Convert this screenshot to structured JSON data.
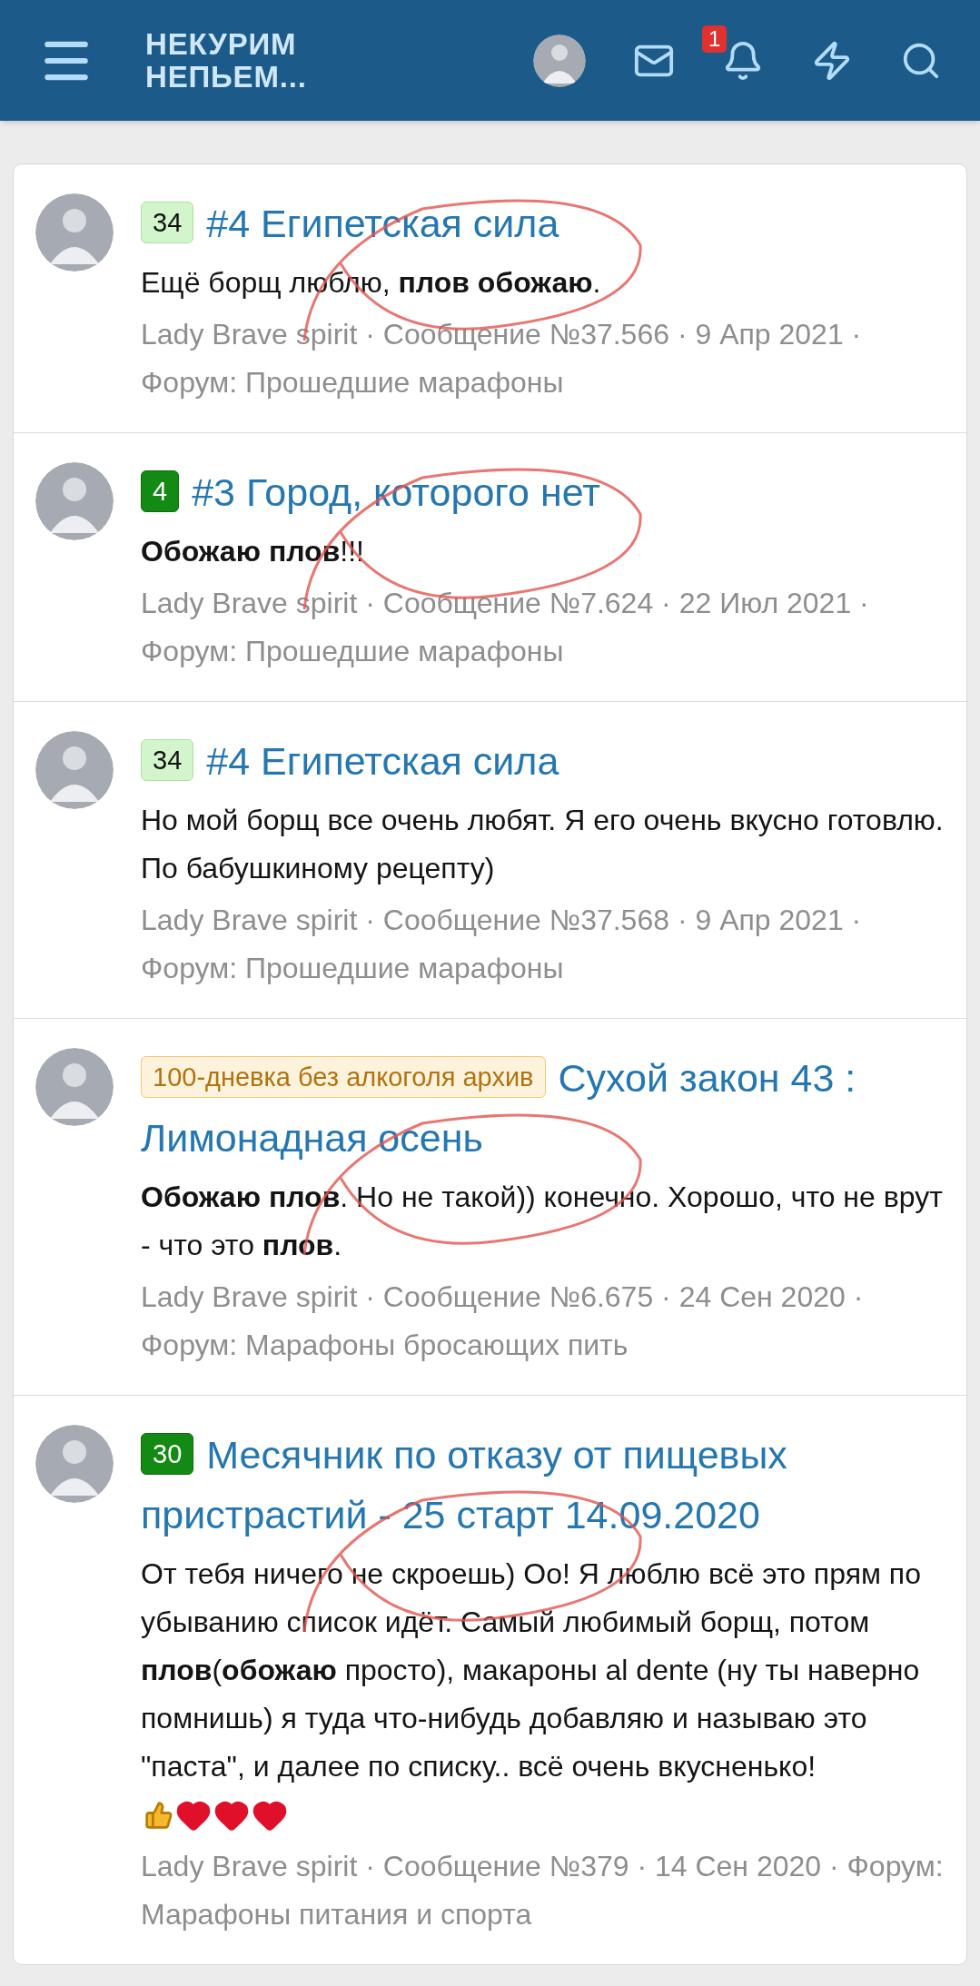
{
  "header": {
    "logo_lines": [
      "НЕКУРИМ",
      "НЕПЬЕМ..."
    ],
    "notification_count": "1"
  },
  "results": [
    {
      "badge": {
        "text": "34",
        "kind": "light"
      },
      "title": "#4 Египетская сила",
      "body": "Ещё борщ люблю, **плов обожаю**.",
      "meta": "Lady Brave spirit · Сообщение №37.566 · 9 Апр 2021 · Форум: Прошедшие марафоны",
      "emoji": false,
      "circled": true
    },
    {
      "badge": {
        "text": "4",
        "kind": "dark"
      },
      "title": "#3 Город, которого нет",
      "body": "**Обожаю плов**!!!",
      "meta": "Lady Brave spirit · Сообщение №7.624 · 22 Июл 2021 · Форум: Прошедшие марафоны",
      "emoji": false,
      "circled": true
    },
    {
      "badge": {
        "text": "34",
        "kind": "light"
      },
      "title": "#4 Египетская сила",
      "body": "Но мой борщ все очень любят. Я его очень вкусно готовлю. По бабушкиному рецепту)",
      "meta": "Lady Brave spirit · Сообщение №37.568 · 9 Апр 2021 · Форум: Прошедшие марафоны",
      "emoji": false,
      "circled": false
    },
    {
      "badge": {
        "text": "100-дневка без алкоголя архив",
        "kind": "amber"
      },
      "title": "Сухой закон 43 : Лимонадная осень",
      "body": "**Обожаю плов**. Но не такой)) конечно. Хорошо, что не врут - что это **плов**.",
      "meta": "Lady Brave spirit · Сообщение №6.675 · 24 Сен 2020 · Форум: Марафоны бросающих пить",
      "emoji": false,
      "circled": true
    },
    {
      "badge": {
        "text": "30",
        "kind": "dark"
      },
      "title": "Месячник по отказу от пищевых пристрастий - 25 старт 14.09.2020",
      "body": "От тебя ничего не скроешь) Оо! Я люблю всё это прям по убыванию список идёт. Самый любимый борщ, потом **плов**(**обожаю** просто), макароны al dente (ну ты наверно помнишь) я туда что-нибудь добавляю и называю это \"паста\", и далее по списку.. всё очень вкусненько!",
      "meta": "Lady Brave spirit · Сообщение №379 · 14 Сен 2020 · Форум: Марафоны питания и спорта",
      "emoji": true,
      "circled": true
    }
  ]
}
